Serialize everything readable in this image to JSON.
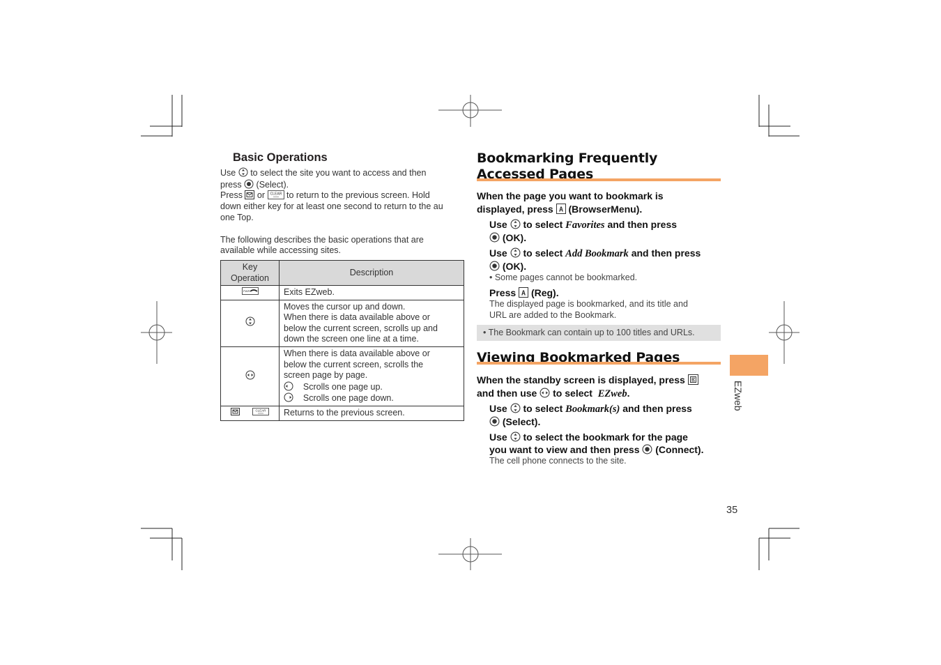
{
  "left": {
    "heading": "Basic Operations",
    "para1": {
      "l1_a": "Use",
      "l1_b": "to select the site you want to access and then",
      "l2_a": "press",
      "l2_b": "(Select).",
      "l3_a": "Press",
      "l3_b": "or",
      "l3_c": "to return to the previous screen. Hold",
      "l4": "down either key for at least one second to return to the au",
      "l5": "one Top."
    },
    "para2": {
      "l1": "The following describes the basic operations that are",
      "l2": "available while accessing sites."
    },
    "table": {
      "headers": [
        "Key Operation",
        "Description"
      ],
      "header_key_l1": "Key",
      "header_key_l2": "Operation",
      "rows": [
        {
          "key_icon": "pwr-end-key-icon",
          "lines": [
            "Exits EZweb."
          ]
        },
        {
          "key_icon": "up-down-key-icon",
          "lines": [
            "Moves the cursor up and down.",
            "When there is data available above or",
            "below the current screen, scrolls up and",
            "down the screen one line at a time."
          ]
        },
        {
          "key_icon": "left-right-key-icon",
          "lines": [
            "When there is data available above or",
            "below the current screen, scrolls the",
            "screen page by page."
          ],
          "sub": [
            "Scrolls one page up.",
            "Scrolls one page down."
          ]
        },
        {
          "key_icon": "mail-clear-keys-icon",
          "lines": [
            "Returns to the previous screen."
          ]
        }
      ]
    }
  },
  "right": {
    "section1": {
      "title_l1": "Bookmarking Frequently",
      "title_l2": "Accessed Pages",
      "lead_l1": "When the page you want to bookmark is",
      "lead_l2_a": "displayed, press",
      "lead_l2_b": "(BrowserMenu).",
      "step1_a": "Use",
      "step1_b": "to select",
      "step1_item": "Favorites",
      "step1_c": "and then press",
      "step1_d": "(OK).",
      "step2_a": "Use",
      "step2_b": "to select",
      "step2_item": "Add Bookmark",
      "step2_c": "and then press",
      "step2_d": "(OK).",
      "step2_note": "• Some pages cannot be bookmarked.",
      "step3_a": "Press",
      "step3_b": "(Reg).",
      "step3_desc_l1": "The displayed page is bookmarked, and its title and",
      "step3_desc_l2": "URL are added to the Bookmark.",
      "note": "• The Bookmark can contain up to 100 titles and URLs."
    },
    "section2": {
      "title": "Viewing Bookmarked Pages",
      "lead_l1_a": "When the standby screen is displayed, press",
      "lead_l2_a": "and then use",
      "lead_l2_b": "to select",
      "lead_l2_item": "EZweb",
      "step1_a": "Use",
      "step1_b": "to select",
      "step1_item": "Bookmark(s)",
      "step1_c": "and then press",
      "step1_d": "(Select).",
      "step2_l1_a": "Use",
      "step2_l1_b": "to select the bookmark for the page",
      "step2_l2_a": "you want to view and then press",
      "step2_l2_b": "(Connect).",
      "step2_desc": "The cell phone connects to the site."
    }
  },
  "side_tab": {
    "label": "EZweb",
    "color": "#f4a464"
  },
  "page_number": "35"
}
